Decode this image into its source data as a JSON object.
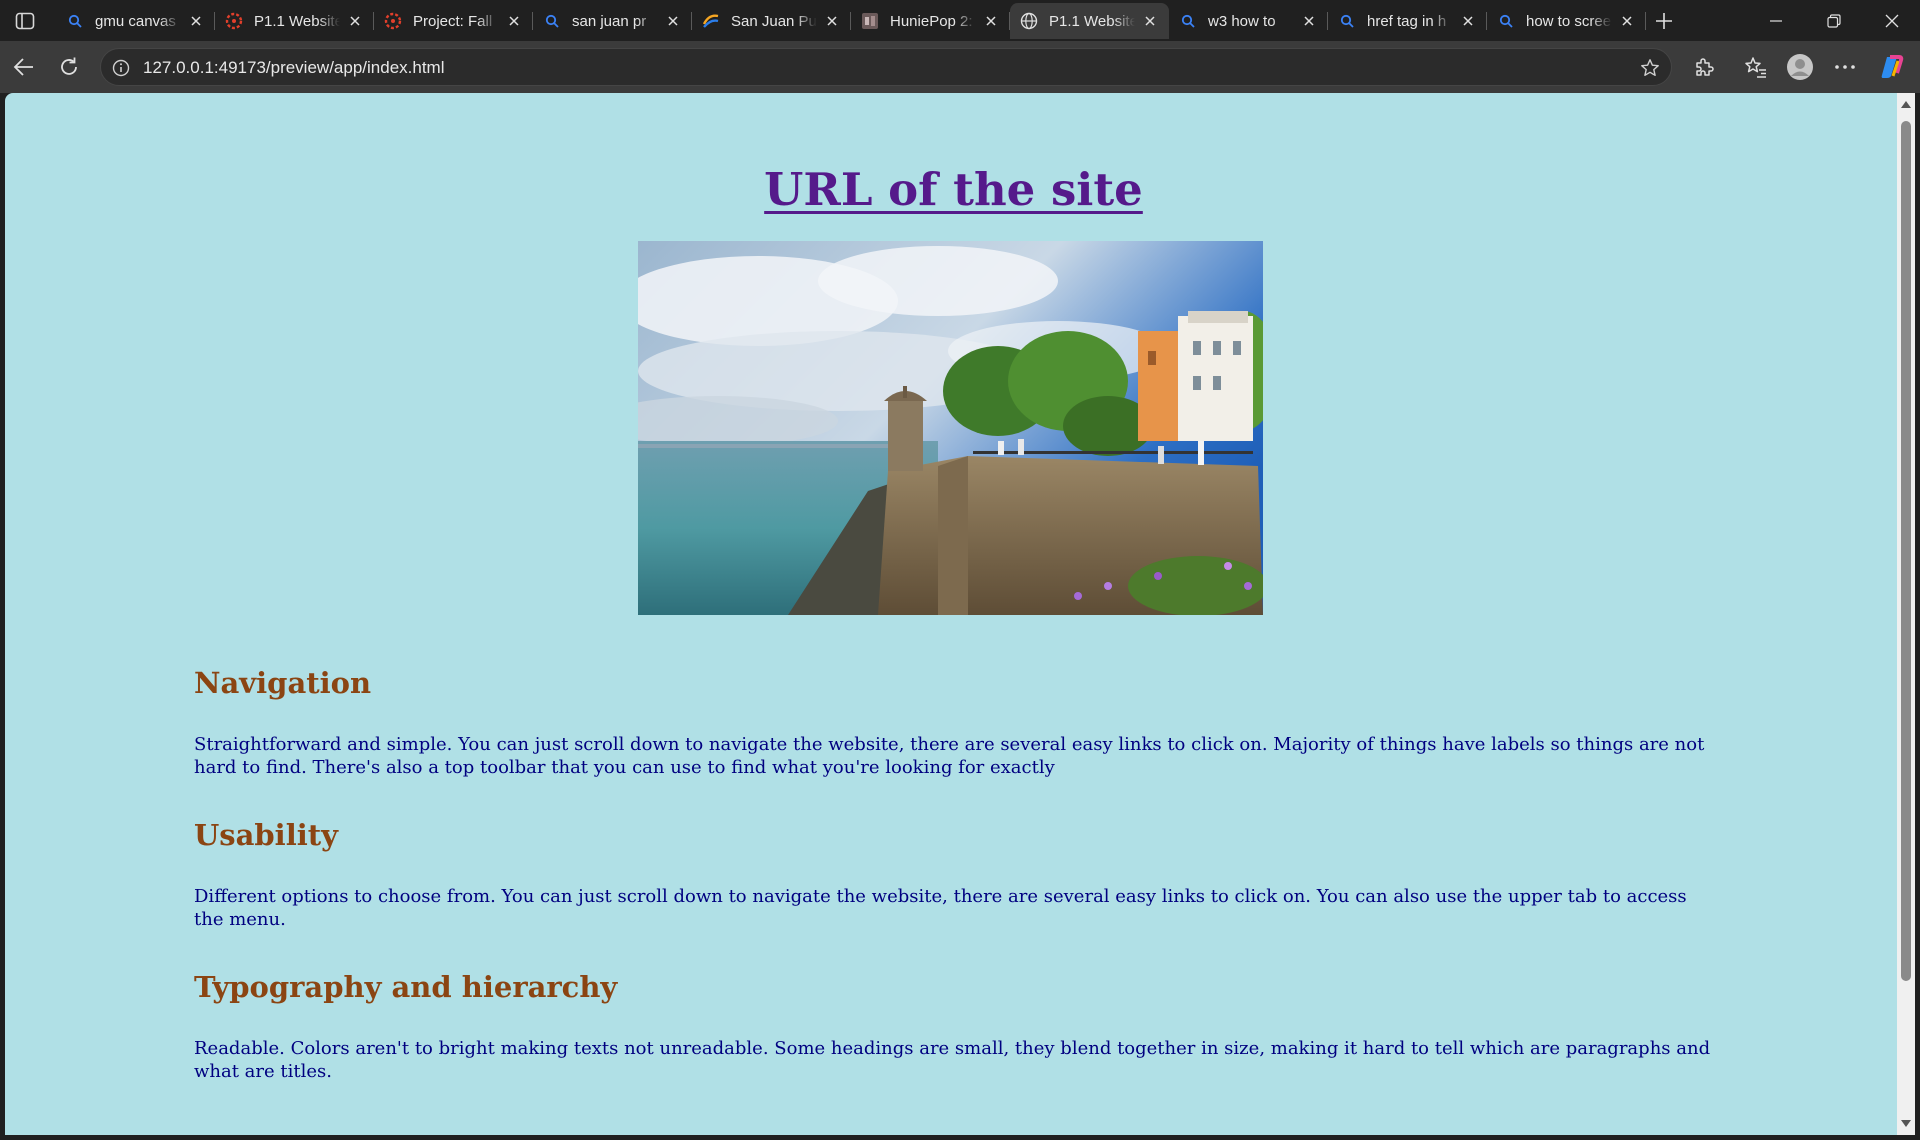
{
  "browser": {
    "tabs": [
      {
        "title": "gmu canvas",
        "icon": "search-icon",
        "active": false
      },
      {
        "title": "P1.1 Website",
        "icon": "canvas-logo-icon",
        "active": false
      },
      {
        "title": "Project: Fall",
        "icon": "canvas-logo-icon",
        "active": false
      },
      {
        "title": "san juan pr",
        "icon": "search-icon",
        "active": false
      },
      {
        "title": "San Juan Pu",
        "icon": "travel-site-icon",
        "active": false
      },
      {
        "title": "HuniePop 2:",
        "icon": "game-site-icon",
        "active": false
      },
      {
        "title": "P1.1 Website",
        "icon": "globe-icon",
        "active": true
      },
      {
        "title": "w3 how to",
        "icon": "search-icon",
        "active": false
      },
      {
        "title": "href tag in h",
        "icon": "search-icon",
        "active": false
      },
      {
        "title": "how to scree",
        "icon": "search-icon",
        "active": false
      }
    ],
    "address_bar": {
      "url": "127.0.0.1:49173/preview/app/index.html"
    }
  },
  "page": {
    "background_color": "#b0e0e6",
    "title": "URL of the site",
    "hero_image": "san-juan-coastal-fortress-photo",
    "sections": [
      {
        "heading": "Navigation",
        "body": "Straightforward and simple. You can just scroll down to navigate the website, there are several easy links to click on. Majority of things have labels so things are not hard to find. There's also a top toolbar that you can use to find what you're looking for exactly"
      },
      {
        "heading": "Usability",
        "body": "Different options to choose from. You can just scroll down to navigate the website, there are several easy links to click on. You can also use the upper tab to access the menu."
      },
      {
        "heading": "Typography and hierarchy",
        "body": "Readable. Colors aren't to bright making texts not unreadable. Some headings are small, they blend together in size, making it hard to tell which are paragraphs and what are titles."
      }
    ],
    "colors": {
      "title": "#551a8b",
      "heading": "#8b4513",
      "body_text": "#000080"
    }
  }
}
